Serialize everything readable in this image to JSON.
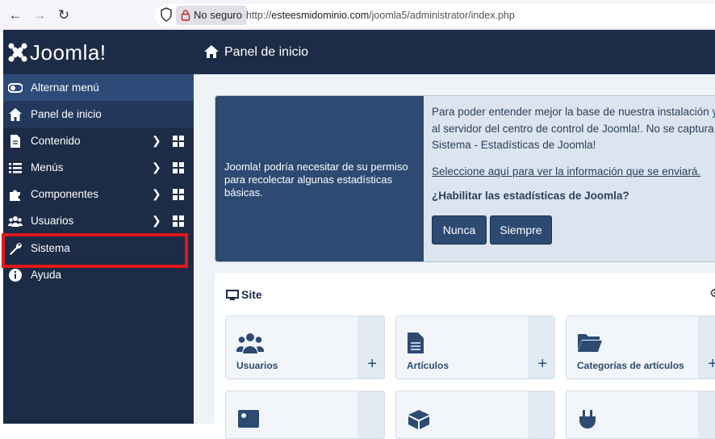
{
  "browser": {
    "secure_label": "No seguro",
    "url_prefix": "http://",
    "url_domain": "esteesmidominio.com",
    "url_path": "/joomla5/administrator/index.php",
    "back_icon": "arrow-left-icon",
    "forward_icon": "arrow-right-icon",
    "reload_icon": "reload-icon"
  },
  "brand": {
    "name": "Joomla!"
  },
  "sidebar": {
    "items": [
      {
        "label": "Alternar menú",
        "icon": "toggle-icon"
      },
      {
        "label": "Panel de inicio",
        "icon": "home-icon"
      },
      {
        "label": "Contenido",
        "icon": "file-icon"
      },
      {
        "label": "Menús",
        "icon": "list-icon"
      },
      {
        "label": "Componentes",
        "icon": "puzzle-icon"
      },
      {
        "label": "Usuarios",
        "icon": "users-icon"
      },
      {
        "label": "Sistema",
        "icon": "wrench-icon"
      },
      {
        "label": "Ayuda",
        "icon": "info-icon"
      }
    ]
  },
  "header": {
    "title": "Panel de inicio"
  },
  "stats": {
    "left_text": "Joomla! podría necesitar de su permiso para recolectar algunas estadísticas básicas.",
    "line1": "Para poder entender mejor la base de nuestra instalación y",
    "line2": "al servidor del centro de control de Joomla!. No se captura",
    "line3": "Sistema - Estadísticas de Joomla!",
    "link": "Seleccione aquí para ver la información que se enviará.",
    "question": "¿Habilitar las estadísticas de Joomla?",
    "btn_never": "Nunca",
    "btn_always": "Siempre"
  },
  "site": {
    "title": "Site",
    "tiles": [
      {
        "label": "Usuarios",
        "icon": "users-icon"
      },
      {
        "label": "Artículos",
        "icon": "file-icon"
      },
      {
        "label": "Categorías de artículos",
        "icon": "folder-icon"
      }
    ],
    "plus": "+"
  },
  "colors": {
    "sidebar": "#1c2b46",
    "accent": "#2c4a72",
    "highlight": "#e0191a"
  }
}
